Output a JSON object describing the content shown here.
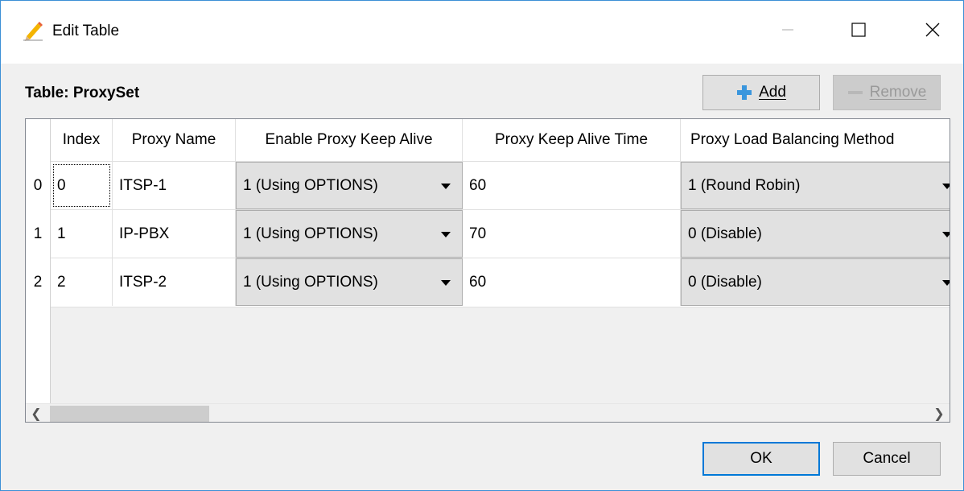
{
  "window": {
    "title": "Edit Table",
    "icon": "pencil-icon",
    "controls": {
      "minimize_icon": "minimize-icon",
      "maximize_icon": "maximize-icon",
      "close_icon": "close-icon"
    }
  },
  "table_label": "Table: ProxySet",
  "toolbar": {
    "add_label": "Add",
    "add_icon": "plus-icon",
    "remove_label": "Remove",
    "remove_icon": "minus-icon"
  },
  "grid": {
    "columns": [
      "Index",
      "Proxy Name",
      "Enable Proxy Keep Alive",
      "Proxy Keep Alive Time",
      "Proxy Load Balancing Method"
    ],
    "rows": [
      {
        "rownum": "0",
        "index": "0",
        "name": "ITSP-1",
        "keepalive": "1 (Using OPTIONS)",
        "time": "60",
        "balancing": "1 (Round Robin)"
      },
      {
        "rownum": "1",
        "index": "1",
        "name": "IP-PBX",
        "keepalive": "1 (Using OPTIONS)",
        "time": "70",
        "balancing": "0 (Disable)"
      },
      {
        "rownum": "2",
        "index": "2",
        "name": "ITSP-2",
        "keepalive": "1 (Using OPTIONS)",
        "time": "60",
        "balancing": "0 (Disable)"
      }
    ]
  },
  "footer": {
    "ok_label": "OK",
    "cancel_label": "Cancel"
  },
  "colors": {
    "accent": "#0078d7",
    "add_icon": "#3a96dd"
  }
}
